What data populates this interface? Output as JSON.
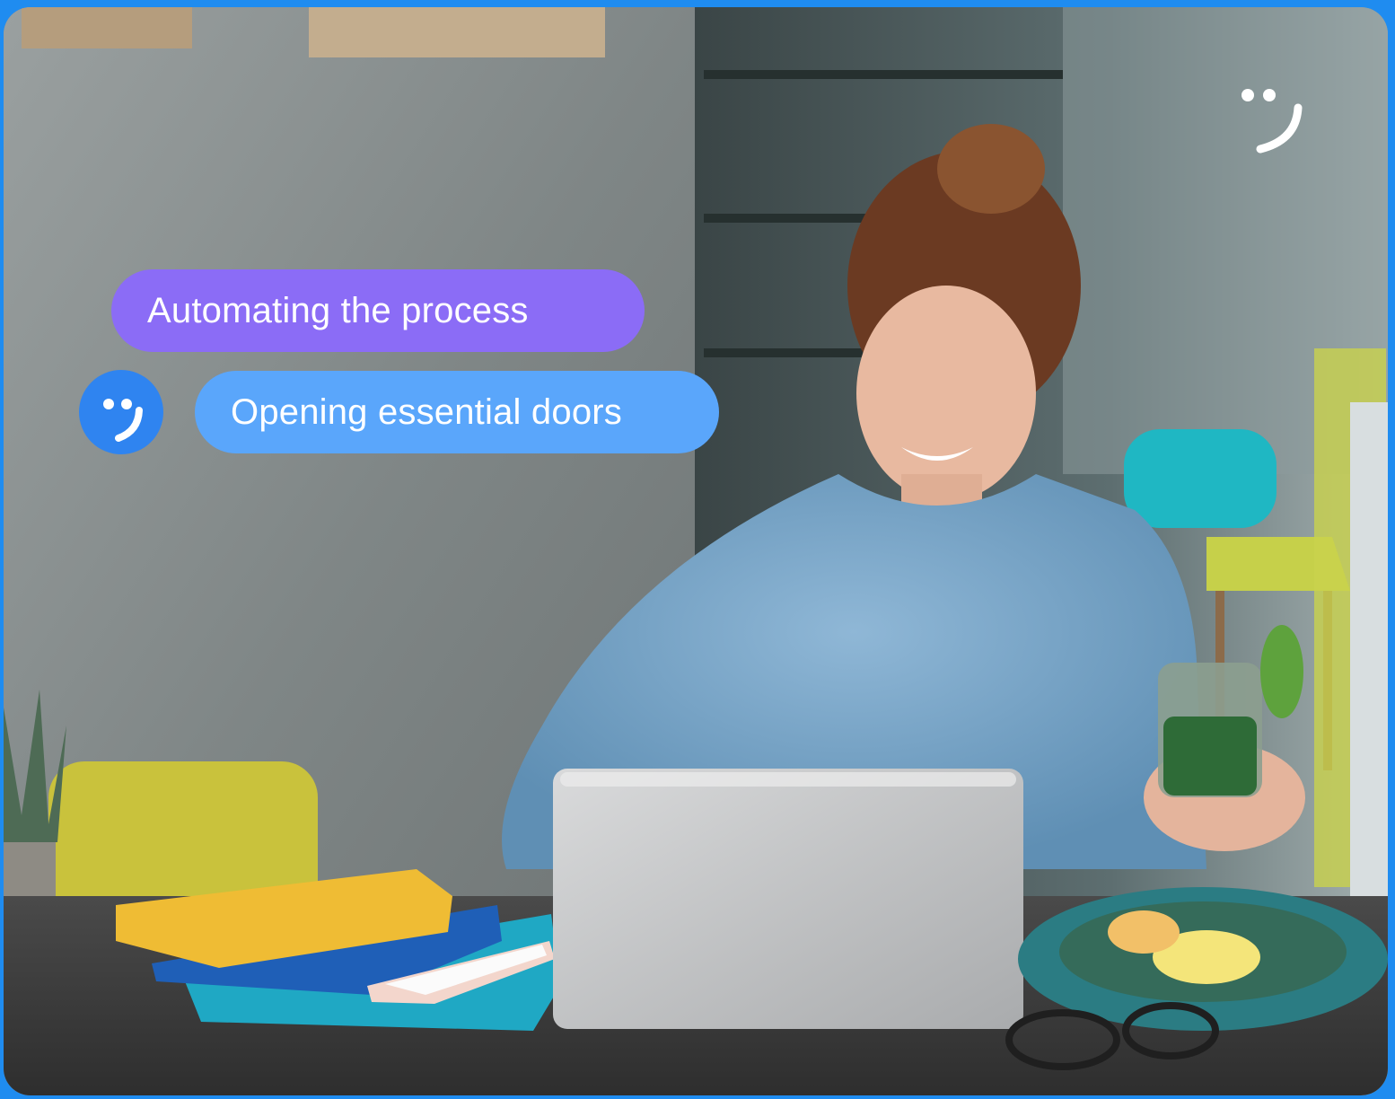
{
  "colors": {
    "frame_border": "#1f8cf0",
    "bubble_primary": "#8b6cf6",
    "bubble_secondary": "#5aa6fb",
    "avatar_bg": "#2f84f0",
    "logo": "#ffffff"
  },
  "chat": {
    "message_1": "Automating the process",
    "message_2": "Opening essential doors"
  },
  "icons": {
    "brand": "smiley-wink-icon",
    "avatar": "smiley-wink-icon"
  }
}
